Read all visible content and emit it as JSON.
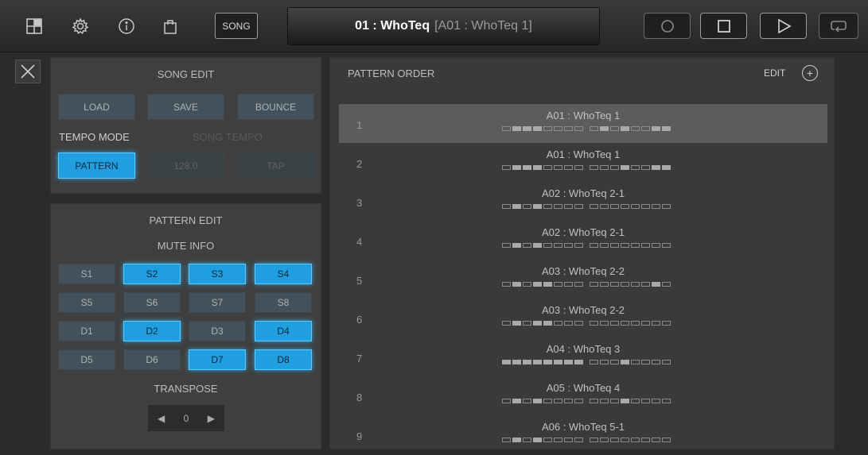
{
  "toolbar": {
    "icons": [
      "pattern-grid-icon",
      "gear-icon",
      "info-icon",
      "shopping-bag-icon"
    ],
    "song_label": "SONG",
    "song_title": "01 : WhoTeq",
    "song_pattern": "[A01 : WhoTeq 1]"
  },
  "song_edit": {
    "title": "SONG EDIT",
    "load": "LOAD",
    "save": "SAVE",
    "bounce": "BOUNCE",
    "tempo_mode_label": "TEMPO MODE",
    "song_tempo_label": "SONG TEMPO",
    "pattern": "PATTERN",
    "tempo_value": "128.0",
    "tap": "TAP"
  },
  "pattern_edit": {
    "title": "PATTERN EDIT",
    "mute_info": "MUTE INFO",
    "mutes": [
      {
        "label": "S1",
        "on": false
      },
      {
        "label": "S2",
        "on": true
      },
      {
        "label": "S3",
        "on": true
      },
      {
        "label": "S4",
        "on": true
      },
      {
        "label": "S5",
        "on": false
      },
      {
        "label": "S6",
        "on": false
      },
      {
        "label": "S7",
        "on": false
      },
      {
        "label": "S8",
        "on": false
      },
      {
        "label": "D1",
        "on": false
      },
      {
        "label": "D2",
        "on": true
      },
      {
        "label": "D3",
        "on": false
      },
      {
        "label": "D4",
        "on": true
      },
      {
        "label": "D5",
        "on": false
      },
      {
        "label": "D6",
        "on": false
      },
      {
        "label": "D7",
        "on": true
      },
      {
        "label": "D8",
        "on": true
      }
    ],
    "transpose_label": "TRANSPOSE",
    "transpose_value": "0"
  },
  "pattern_order": {
    "title": "PATTERN ORDER",
    "edit": "EDIT",
    "rows": [
      {
        "num": "1",
        "name": "A01 : WhoTeq 1",
        "selected": true,
        "steps": [
          0,
          1,
          1,
          1,
          0,
          0,
          0,
          0,
          0,
          1,
          0,
          1,
          0,
          0,
          1,
          1
        ]
      },
      {
        "num": "2",
        "name": "A01 : WhoTeq 1",
        "selected": false,
        "steps": [
          0,
          1,
          1,
          1,
          0,
          0,
          0,
          0,
          0,
          0,
          0,
          1,
          0,
          0,
          1,
          1
        ]
      },
      {
        "num": "3",
        "name": "A02 : WhoTeq 2-1",
        "selected": false,
        "steps": [
          0,
          1,
          0,
          1,
          0,
          0,
          0,
          0,
          0,
          0,
          0,
          0,
          0,
          0,
          0,
          0
        ]
      },
      {
        "num": "4",
        "name": "A02 : WhoTeq 2-1",
        "selected": false,
        "steps": [
          0,
          1,
          0,
          1,
          0,
          0,
          0,
          0,
          0,
          0,
          0,
          0,
          0,
          0,
          0,
          0
        ]
      },
      {
        "num": "5",
        "name": "A03 : WhoTeq 2-2",
        "selected": false,
        "steps": [
          0,
          1,
          0,
          1,
          1,
          0,
          0,
          0,
          0,
          0,
          0,
          0,
          0,
          0,
          1,
          0
        ]
      },
      {
        "num": "6",
        "name": "A03 : WhoTeq 2-2",
        "selected": false,
        "steps": [
          0,
          1,
          0,
          1,
          1,
          0,
          0,
          0,
          0,
          0,
          0,
          0,
          0,
          0,
          0,
          0
        ]
      },
      {
        "num": "7",
        "name": "A04 : WhoTeq 3",
        "selected": false,
        "steps": [
          1,
          1,
          1,
          1,
          1,
          1,
          1,
          1,
          0,
          0,
          0,
          1,
          0,
          0,
          0,
          0
        ]
      },
      {
        "num": "8",
        "name": "A05 : WhoTeq 4",
        "selected": false,
        "steps": [
          0,
          1,
          0,
          1,
          0,
          0,
          0,
          0,
          0,
          0,
          0,
          1,
          0,
          0,
          0,
          0
        ]
      },
      {
        "num": "9",
        "name": "A06 : WhoTeq 5-1",
        "selected": false,
        "steps": [
          0,
          1,
          0,
          1,
          0,
          0,
          0,
          0,
          0,
          0,
          0,
          0,
          0,
          0,
          0,
          0
        ]
      }
    ]
  },
  "colors": {
    "accent": "#1f9ee0",
    "selected_row": "#5c5c5c"
  }
}
